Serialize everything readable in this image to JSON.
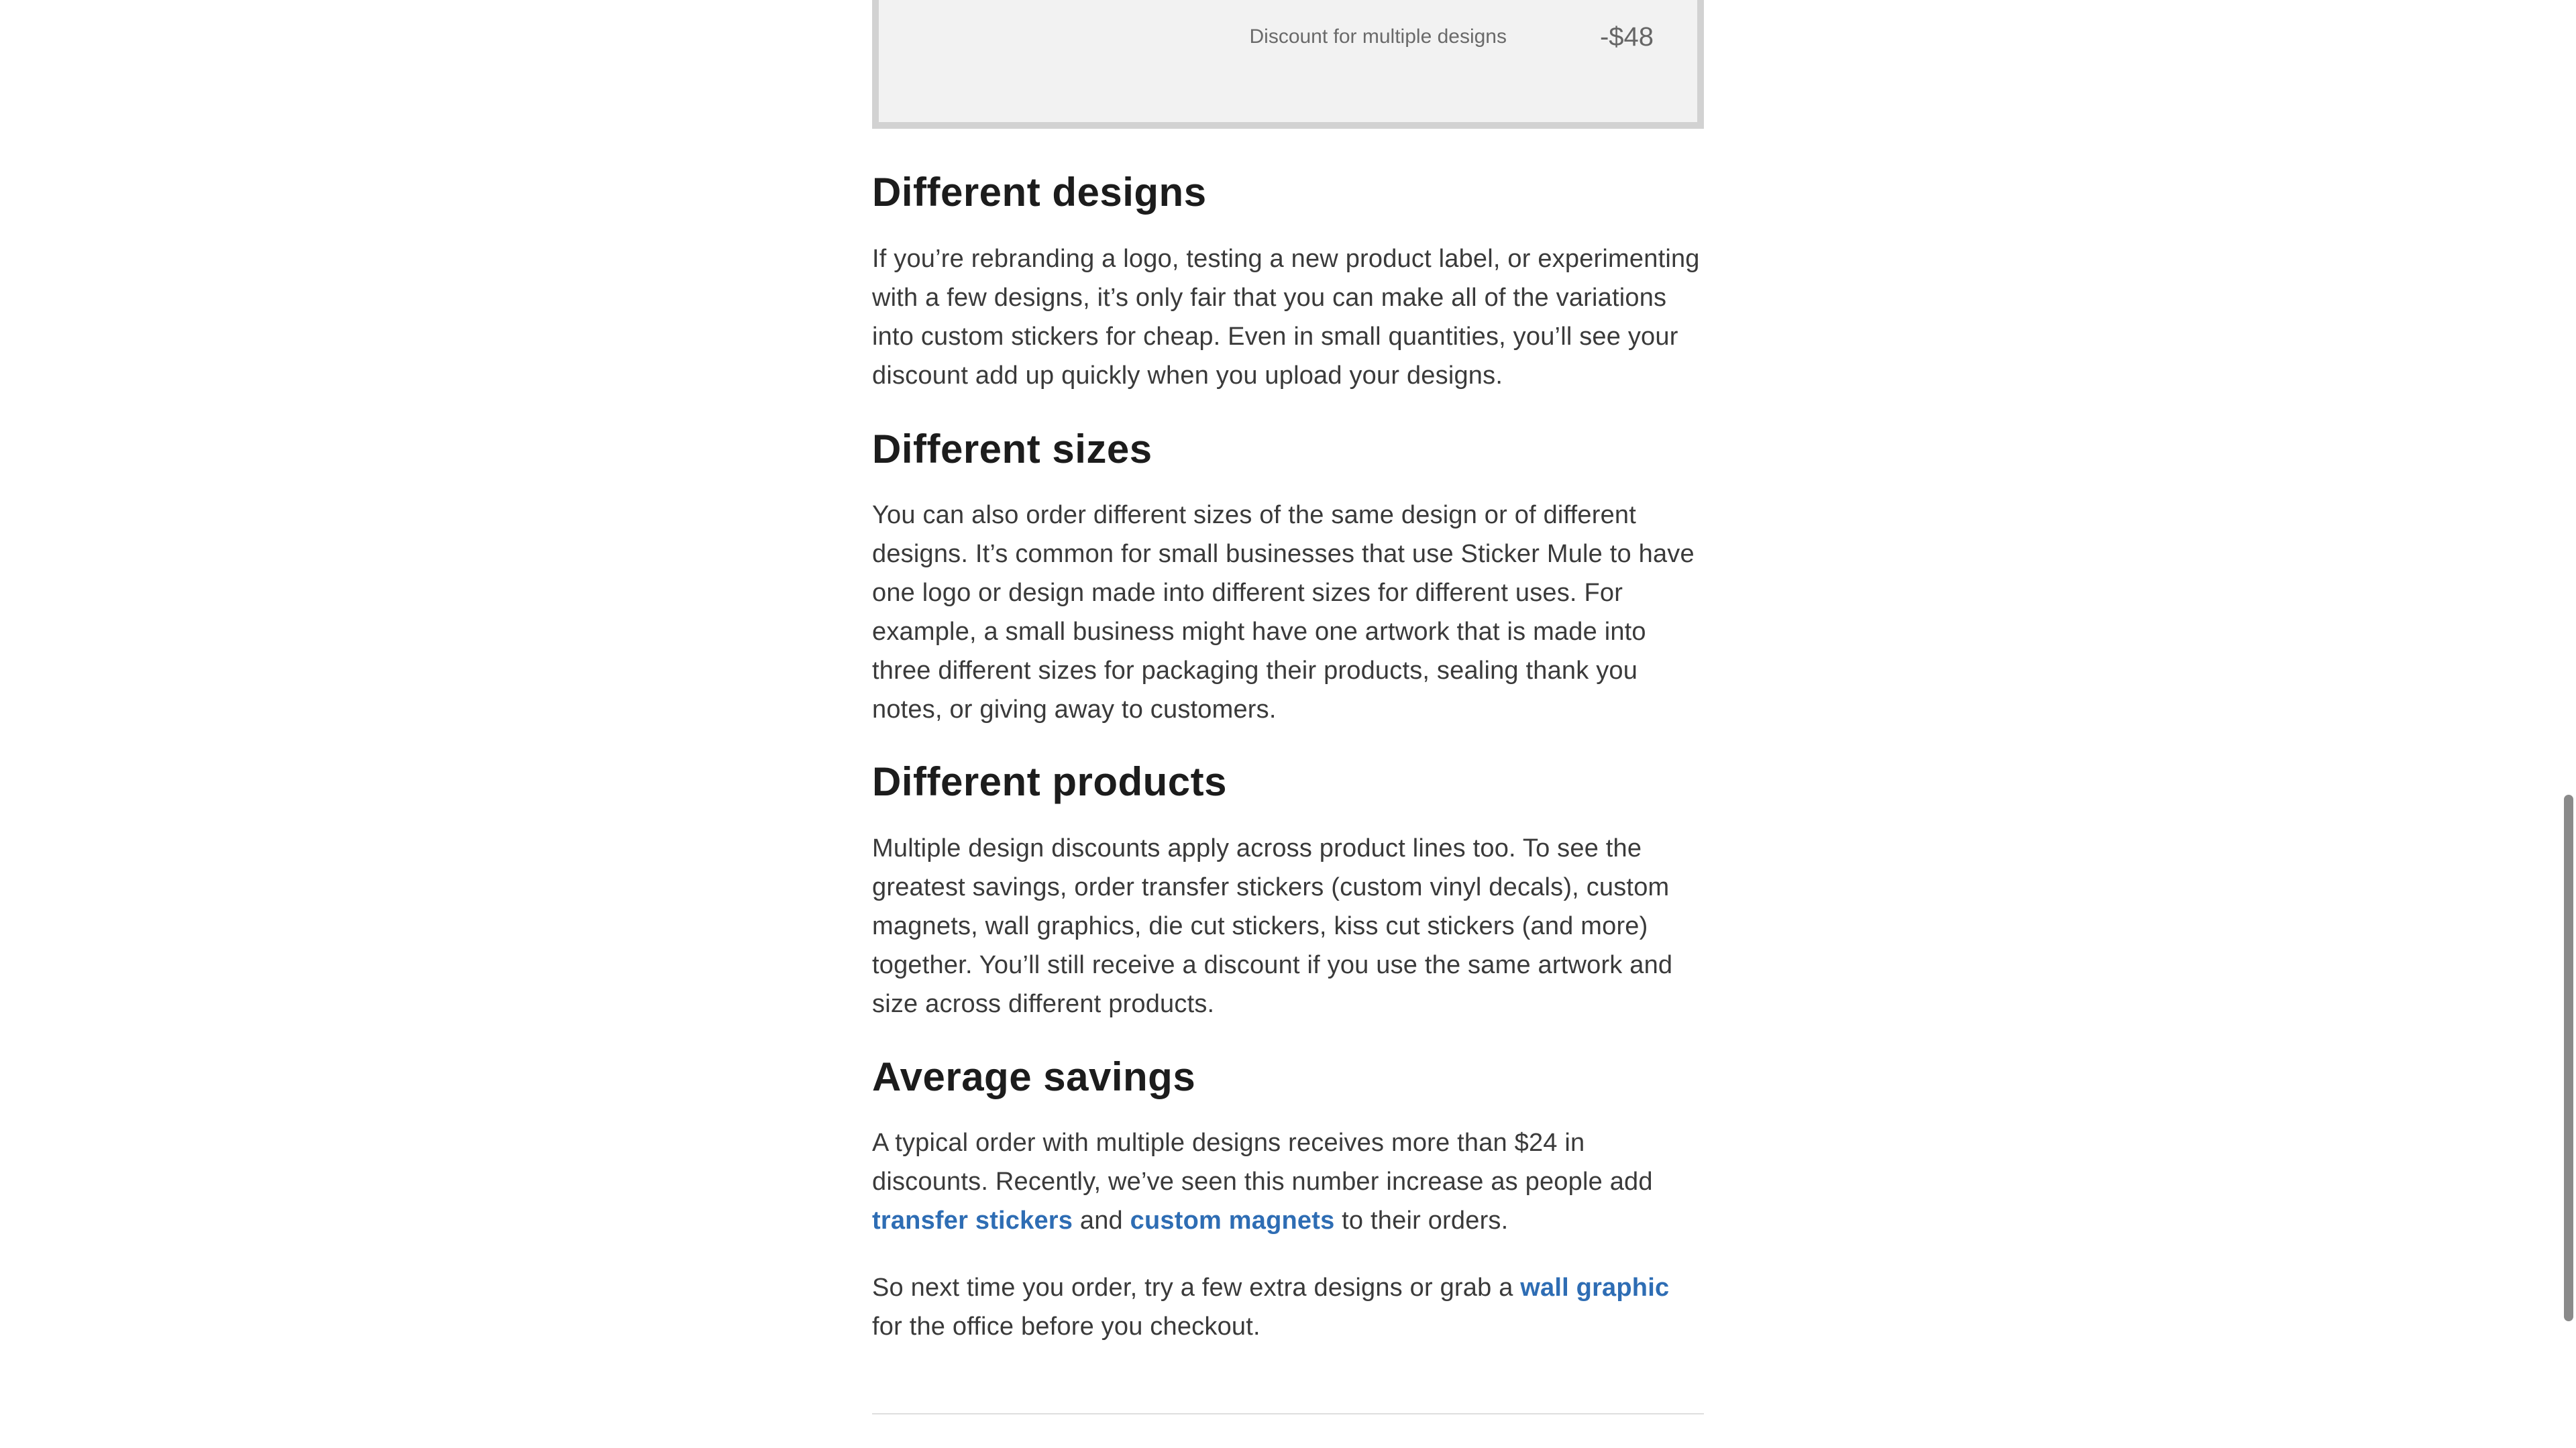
{
  "discount_box": {
    "label": "Discount for multiple designs",
    "amount": "-$48"
  },
  "sections": {
    "designs": {
      "heading": "Different designs",
      "body": "If you’re rebranding a logo, testing a new product label, or experimenting with a few designs, it’s only fair that you can make all of the variations into custom stickers for cheap. Even in small quantities, you’ll see your discount add up quickly when you upload your designs."
    },
    "sizes": {
      "heading": "Different sizes",
      "body": "You can also order different sizes of the same design or of different designs. It’s common for small businesses that use Sticker Mule to have one logo or design made into different sizes for different uses. For example, a small business might have one artwork that is made into three different sizes for packaging their products, sealing thank you notes, or giving away to customers."
    },
    "products": {
      "heading": "Different products",
      "body": "Multiple design discounts apply across product lines too. To see the greatest savings, order transfer stickers (custom vinyl decals), custom magnets, wall graphics, die cut stickers, kiss cut stickers (and more) together. You’ll still receive a discount if you use the same artwork and size across different products."
    },
    "savings": {
      "heading": "Average savings",
      "p1_before": "A typical order with multiple designs receives more than $24 in discounts. Recently, we’ve seen this number increase as people add ",
      "p1_link1": "transfer stickers",
      "p1_middle": " and ",
      "p1_link2": "custom magnets",
      "p1_after": " to their orders.",
      "p2_before": "So next time you order, try a few extra designs or grab a ",
      "p2_link": "wall graphic",
      "p2_after": " for the office before you checkout."
    }
  }
}
